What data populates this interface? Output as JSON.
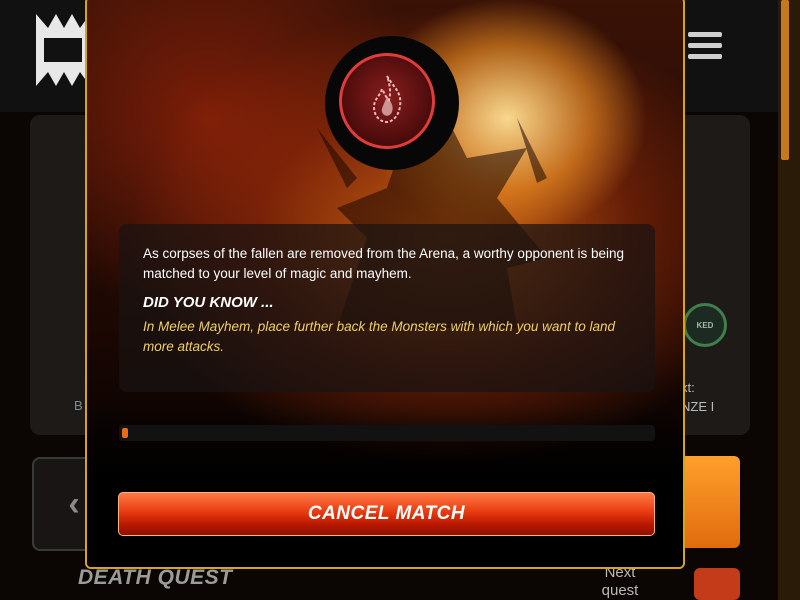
{
  "background": {
    "locked_badge": "KED",
    "left_text": "B",
    "next_label": "xt:",
    "next_value": "NZE I",
    "nav_arrow": "‹",
    "death_quest": "DEATH QUEST",
    "next_quest": "Next quest"
  },
  "modal": {
    "emblem_icon": "flame-icon",
    "matching_text": "As corpses of the fallen are removed from the Arena, a worthy opponent is being matched to your level of magic and mayhem.",
    "did_you_know_heading": "DID YOU KNOW ...",
    "tip_text": "In Melee Mayhem, place further back the Monsters with which you want to land more attacks.",
    "progress_fraction": 0.011,
    "cancel_label": "CANCEL MATCH"
  },
  "colors": {
    "modal_border": "#d8a51a",
    "tip_text": "#f0d060",
    "cancel_button": "#e83a10",
    "emblem_ring": "#e03c3c"
  }
}
